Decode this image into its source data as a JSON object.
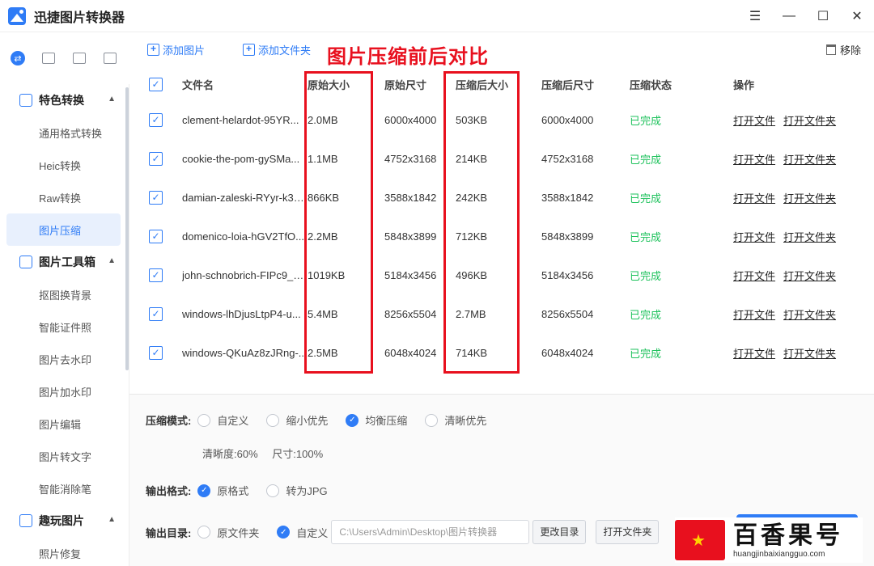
{
  "app": {
    "title": "迅捷图片转换器"
  },
  "window": {
    "menu": "☰",
    "minimize": "—",
    "maximize": "☐",
    "close": "✕"
  },
  "sidebar": {
    "groups": [
      {
        "label": "特色转换",
        "items": [
          "通用格式转换",
          "Heic转换",
          "Raw转换",
          "图片压缩"
        ]
      },
      {
        "label": "图片工具箱",
        "items": [
          "抠图换背景",
          "智能证件照",
          "图片去水印",
          "图片加水印",
          "图片编辑",
          "图片转文字",
          "智能消除笔"
        ]
      },
      {
        "label": "趣玩图片",
        "items": [
          "照片修复"
        ]
      }
    ],
    "active_item": "图片压缩"
  },
  "toolbar": {
    "add_image": "添加图片",
    "add_folder": "添加文件夹",
    "remove": "移除"
  },
  "annotation": "图片压缩前后对比",
  "table": {
    "headers": [
      "文件名",
      "原始大小",
      "原始尺寸",
      "压缩后大小",
      "压缩后尺寸",
      "压缩状态",
      "操作"
    ],
    "rows": [
      {
        "name": "clement-helardot-95YR...",
        "osize": "2.0MB",
        "odim": "6000x4000",
        "csize": "503KB",
        "cdim": "6000x4000",
        "status": "已完成"
      },
      {
        "name": "cookie-the-pom-gySMa...",
        "osize": "1.1MB",
        "odim": "4752x3168",
        "csize": "214KB",
        "cdim": "4752x3168",
        "status": "已完成"
      },
      {
        "name": "damian-zaleski-RYyr-k3Y...",
        "osize": "866KB",
        "odim": "3588x1842",
        "csize": "242KB",
        "cdim": "3588x1842",
        "status": "已完成"
      },
      {
        "name": "domenico-loia-hGV2TfO...",
        "osize": "2.2MB",
        "odim": "5848x3899",
        "csize": "712KB",
        "cdim": "5848x3899",
        "status": "已完成"
      },
      {
        "name": "john-schnobrich-FIPc9_V...",
        "osize": "1019KB",
        "odim": "5184x3456",
        "csize": "496KB",
        "cdim": "5184x3456",
        "status": "已完成"
      },
      {
        "name": "windows-lhDjusLtpP4-u...",
        "osize": "5.4MB",
        "odim": "8256x5504",
        "csize": "2.7MB",
        "cdim": "8256x5504",
        "status": "已完成"
      },
      {
        "name": "windows-QKuAz8zJRng-...",
        "osize": "2.5MB",
        "odim": "6048x4024",
        "csize": "714KB",
        "cdim": "6048x4024",
        "status": "已完成"
      }
    ],
    "open_file": "打开文件",
    "open_folder": "打开文件夹"
  },
  "settings": {
    "mode_label": "压缩模式:",
    "modes": [
      "自定义",
      "缩小优先",
      "均衡压缩",
      "清晰优先"
    ],
    "mode_selected": "均衡压缩",
    "clarity": "清晰度:60%",
    "size": "尺寸:100%",
    "format_label": "输出格式:",
    "formats": [
      "原格式",
      "转为JPG"
    ],
    "format_selected": "原格式",
    "dir_label": "输出目录:",
    "dirs": [
      "原文件夹",
      "自定义"
    ],
    "dir_selected": "自定义",
    "dir_path": "C:\\Users\\Admin\\Desktop\\图片转换器",
    "change_dir": "更改目录",
    "open_folder": "打开文件夹"
  },
  "watermark": {
    "cn": "百香果号",
    "en": "huangjinbaixiangguo.com"
  },
  "colors": {
    "accent": "#2f7cf6",
    "success": "#1ec25c",
    "annotation": "#e8101e"
  }
}
